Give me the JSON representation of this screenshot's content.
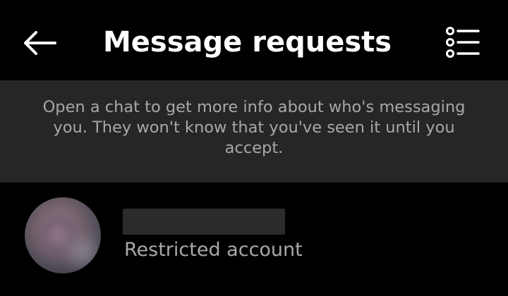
{
  "header": {
    "title": "Message requests",
    "back_icon": "arrow-left-icon",
    "menu_icon": "list-options-icon"
  },
  "info_banner": {
    "text": "Open a chat to get more info about who's messaging you. They won't know that you've seen it until you accept."
  },
  "requests": [
    {
      "name": "",
      "subtitle": "Restricted account"
    }
  ],
  "colors": {
    "background": "#000000",
    "banner": "#262626",
    "primary_text": "#ffffff",
    "secondary_text": "#a8a8a8"
  }
}
